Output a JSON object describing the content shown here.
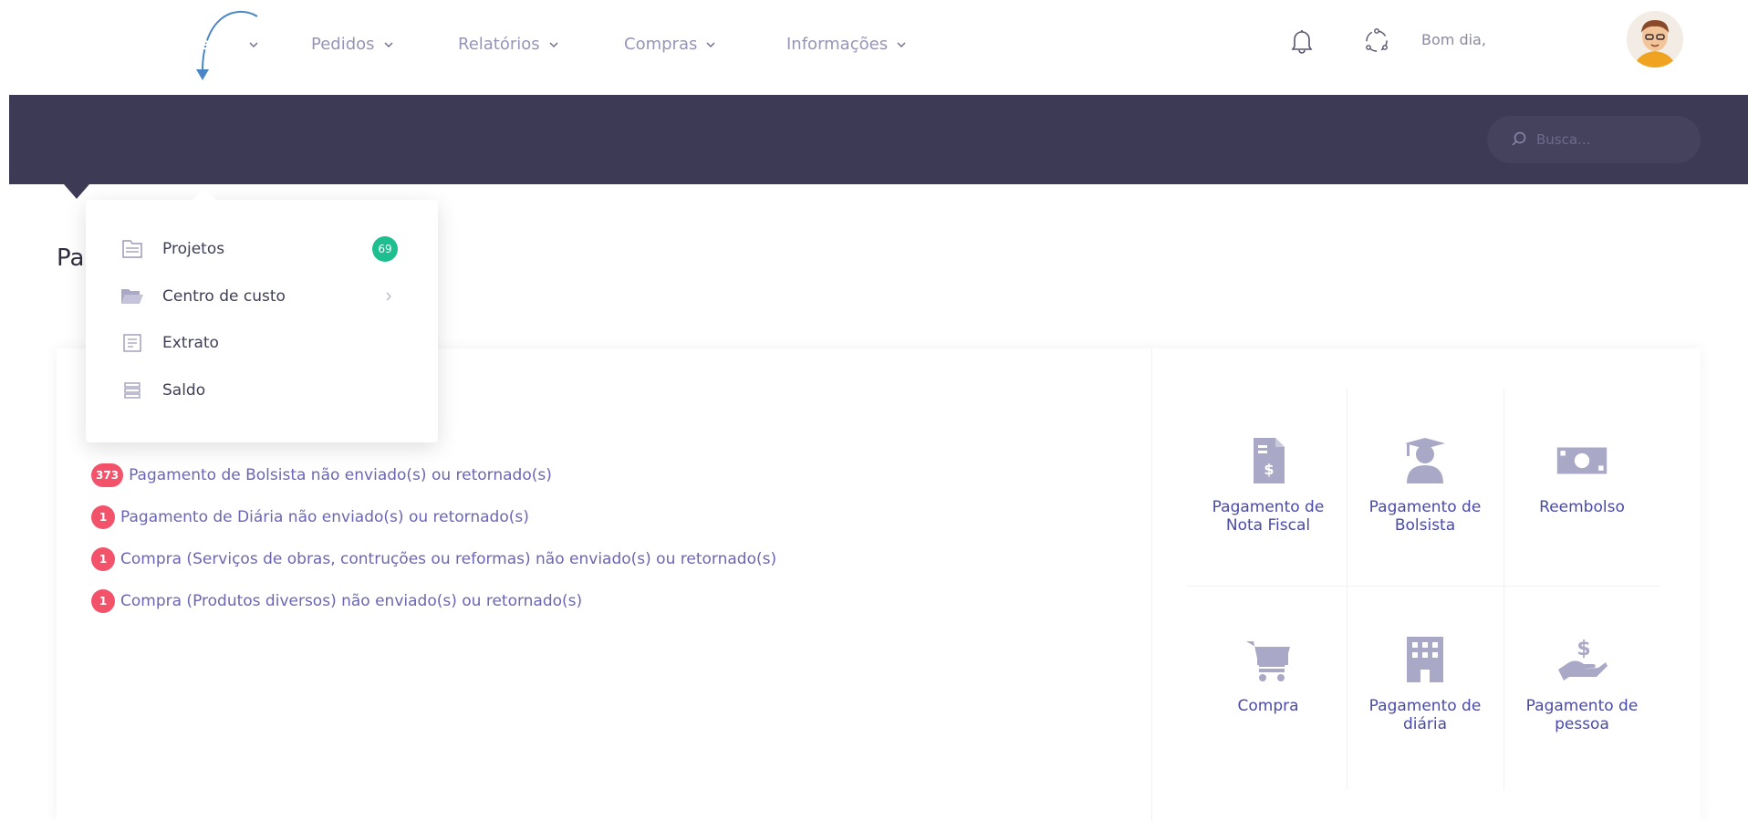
{
  "header": {
    "greeting": "Bom dia,"
  },
  "nav": {
    "items": [
      {
        "label": "Painel",
        "active": true
      },
      {
        "label": "Projetos",
        "active": true
      },
      {
        "label": "Pedidos"
      },
      {
        "label": "Relatórios"
      },
      {
        "label": "Compras"
      },
      {
        "label": "Informações"
      }
    ],
    "search_placeholder": "Busca..."
  },
  "dropdown": {
    "items": [
      {
        "label": "Projetos",
        "badge": "69"
      },
      {
        "label": "Centro de custo"
      },
      {
        "label": "Extrato"
      },
      {
        "label": "Saldo"
      }
    ]
  },
  "page": {
    "title": "Pa"
  },
  "alerts": [
    {
      "count": "373",
      "text": "Pagamento de Bolsista não enviado(s) ou retornado(s)"
    },
    {
      "count": "1",
      "text": "Pagamento de Diária não enviado(s) ou retornado(s)"
    },
    {
      "count": "1",
      "text": "Compra (Serviços de obras, contruções ou reformas) não enviado(s) ou retornado(s)"
    },
    {
      "count": "1",
      "text": "Compra (Produtos diversos) não enviado(s) ou retornado(s)"
    }
  ],
  "tiles": [
    {
      "label": "Pagamento de\nNota Fiscal",
      "icon": "invoice-icon"
    },
    {
      "label": "Pagamento de\nBolsista",
      "icon": "graduate-icon"
    },
    {
      "label": "Reembolso",
      "icon": "cash-icon"
    },
    {
      "label": "Compra",
      "icon": "cart-icon"
    },
    {
      "label": "Pagamento de\ndiária",
      "icon": "building-icon"
    },
    {
      "label": "Pagamento de\npessoa",
      "icon": "hand-dollar-icon"
    }
  ],
  "colors": {
    "navbar": "#3d3a55",
    "accent_red": "#f2536b",
    "accent_green": "#1dbf8f",
    "link": "#6b66b4",
    "icon_muted": "#a9a8c6"
  }
}
